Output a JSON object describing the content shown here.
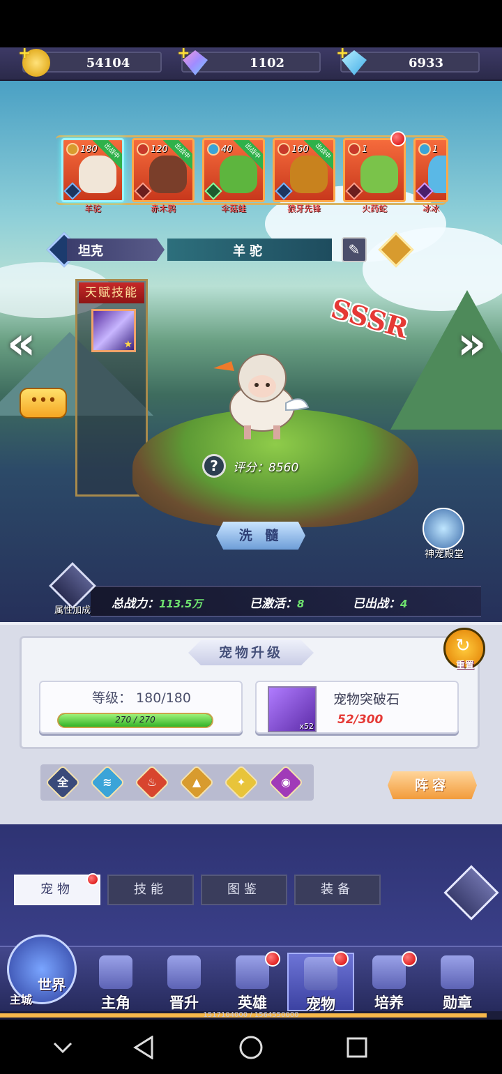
{
  "currency": [
    {
      "name": "gold",
      "value": "54104"
    },
    {
      "name": "diamond-pink",
      "value": "1102"
    },
    {
      "name": "diamond-blue",
      "value": "6933"
    }
  ],
  "roster": [
    {
      "level": "180",
      "badge": "出战中",
      "name": "羊驼",
      "color": "#f1e6d8",
      "selected": true
    },
    {
      "level": "120",
      "badge": "出战中",
      "name": "赤木鸦",
      "color": "#7a3e2a"
    },
    {
      "level": "40",
      "badge": "出战中",
      "name": "伞菇蛙",
      "color": "#5db53e"
    },
    {
      "level": "160",
      "badge": "出战中",
      "name": "狼牙先锋",
      "color": "#c8821e"
    },
    {
      "level": "1",
      "badge": "",
      "name": "火药蛇",
      "color": "#7ac34a"
    },
    {
      "level": "1",
      "badge": "",
      "name": "冰冰",
      "color": "#5ab8e6"
    }
  ],
  "pet_info": {
    "class": "坦克",
    "name": "羊驼",
    "rarity": "SSSR",
    "talent_title": "天赋技能",
    "score_label": "评分：8560",
    "wash_label": "洗 髓"
  },
  "temple_label": "神宠殿堂",
  "attr_label": "属性加成",
  "stats": {
    "power_label": "总战力：",
    "power_value": "113.5万",
    "activated_label": "已激活：",
    "activated_value": "8",
    "deployed_label": "已出战：",
    "deployed_value": "4"
  },
  "upgrade": {
    "title": "宠物升级",
    "reset_label": "重置",
    "level_text": "等级： 180/180",
    "xp_text": "270 / 270",
    "xp_fraction": 1.0,
    "stone_name": "宠物突破石",
    "stone_count": "x52",
    "stone_progress": "52/300"
  },
  "filters": [
    {
      "name": "all",
      "glyph": "全",
      "color": "#3a4a7a"
    },
    {
      "name": "water",
      "glyph": "≋",
      "color": "#3ba4d8"
    },
    {
      "name": "fire",
      "glyph": "♨",
      "color": "#d8452e"
    },
    {
      "name": "earth",
      "glyph": "▲",
      "color": "#d89b2e"
    },
    {
      "name": "light",
      "glyph": "✦",
      "color": "#e8c43a"
    },
    {
      "name": "dark",
      "glyph": "◉",
      "color": "#a03ab8"
    }
  ],
  "lineup_label": "阵容",
  "subtabs": [
    "宠物",
    "技能",
    "图鉴",
    "装备"
  ],
  "nav": {
    "world": "世界",
    "city": "主城",
    "items": [
      "主角",
      "晋升",
      "英雄",
      "宠物",
      "培养",
      "勋章"
    ]
  },
  "exp_text": "1517104000 / 1564550000",
  "exp_fraction": 0.97
}
